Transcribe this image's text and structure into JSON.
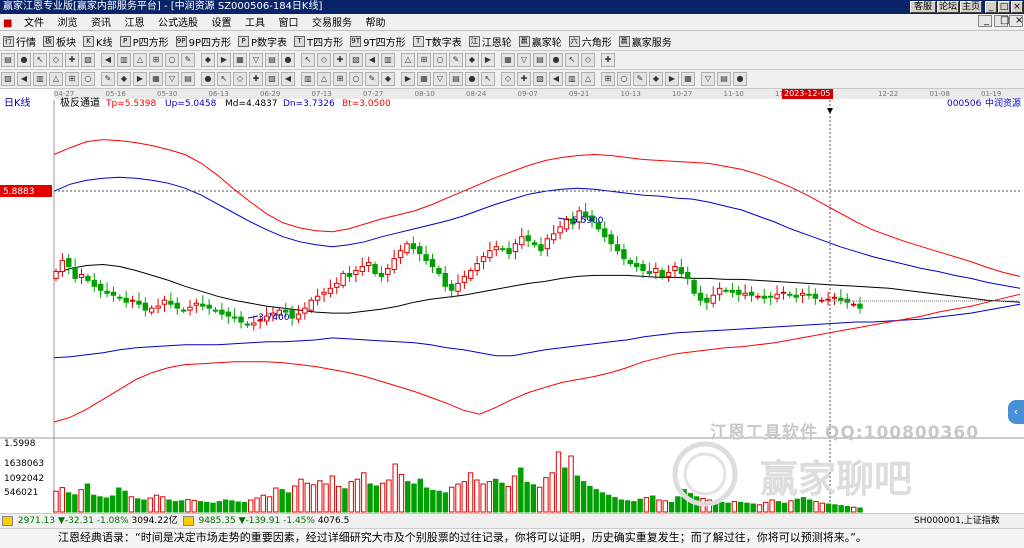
{
  "window": {
    "title": "赢家江恩专业版[赢家内部服务平台] - [中润资源  SZ000506-184日K线]",
    "buttons": [
      "客服",
      "论坛",
      "主页"
    ],
    "controls": [
      "_",
      "□",
      "×"
    ]
  },
  "menu": [
    "文件",
    "浏览",
    "资讯",
    "江恩",
    "公式选股",
    "设置",
    "工具",
    "窗口",
    "交易服务",
    "帮助"
  ],
  "toolbar1": [
    {
      "icon": "行",
      "label": "行情"
    },
    {
      "icon": "板",
      "label": "板块"
    },
    {
      "icon": "K",
      "label": "K线"
    },
    {
      "icon": "P",
      "label": "P四方形"
    },
    {
      "icon": "9P",
      "label": "9P四方形"
    },
    {
      "icon": "P",
      "label": "P数字表"
    },
    {
      "icon": "T",
      "label": "T四方形"
    },
    {
      "icon": "9T",
      "label": "9T四方形"
    },
    {
      "icon": "T",
      "label": "T数字表"
    },
    {
      "icon": "江",
      "label": "江恩轮"
    },
    {
      "icon": "赢",
      "label": "赢家轮"
    },
    {
      "icon": "六",
      "label": "六角形"
    },
    {
      "icon": "赢",
      "label": "赢家服务"
    }
  ],
  "toolbar2_count": 37,
  "toolbar3_count": 45,
  "panel": {
    "period_label": "日K线",
    "indicator": "极反通道",
    "stock_code": "000506",
    "stock_name": "中润资源"
  },
  "legend": [
    {
      "label": "Tp=5.5398",
      "color": "#ff0000"
    },
    {
      "label": "Up=5.0458",
      "color": "#0000cc"
    },
    {
      "label": "Md=4.4837",
      "color": "#000000"
    },
    {
      "label": "Dn=3.7326",
      "color": "#0000cc"
    },
    {
      "label": "Bt=3.0500",
      "color": "#ff0000"
    }
  ],
  "price_marker": "5.8883",
  "annotations": {
    "high": "5.5900",
    "low": "3.7400"
  },
  "dates": [
    "04-27",
    "05-16",
    "05-30",
    "06-13",
    "06-29",
    "07-13",
    "07-27",
    "08-10",
    "08-24",
    "09-07",
    "09-21",
    "10-13",
    "10-27",
    "11-10",
    "11-24",
    "2023-12-05",
    "12-22",
    "01-08",
    "01-19"
  ],
  "volume_labels": [
    "1.5998",
    "1638063",
    "1092042",
    "546021"
  ],
  "status": {
    "sh_index": "2971.13",
    "sh_change": "▼-32.31",
    "sh_pct": "-1.08%",
    "sh_amount": "3094.22亿",
    "sz_index": "9485.35",
    "sz_change": "▼-139.91",
    "sz_pct": "-1.45%",
    "sz_amount": "4076.5",
    "right_code": "SH000001,上证指数"
  },
  "quote": "江恩经典语录：“时间是决定市场走势的重要因素，经过详细研究大市及个别股票的过往记录，你将可以证明，历史确实重复发生；而了解过往，你将可以预测将来。”。",
  "watermark": {
    "line1": "江恩工具软件  QQ:100800360",
    "line2": "赢家聊吧"
  },
  "colors": {
    "up": "#e00000",
    "down": "#00a000",
    "tp": "#ff0000",
    "up_line": "#0000cc",
    "md": "#000000"
  },
  "chart_data": {
    "type": "candlestick",
    "ylim": [
      2.9,
      6.3
    ],
    "series_lines": {
      "tp": [
        5.75,
        5.82,
        5.88,
        5.9,
        5.89,
        5.87,
        5.84,
        5.8,
        5.75,
        5.66,
        5.54,
        5.4,
        5.27,
        5.15,
        5.06,
        5.01,
        4.98,
        4.97,
        5.0,
        5.05,
        5.1,
        5.14,
        5.18,
        5.24,
        5.31,
        5.38,
        5.45,
        5.52,
        5.58,
        5.64,
        5.69,
        5.72,
        5.74,
        5.75,
        5.74,
        5.72,
        5.7,
        5.69,
        5.68,
        5.67,
        5.66,
        5.63,
        5.6,
        5.55,
        5.49,
        5.42,
        5.34,
        5.25,
        5.16,
        5.07,
        4.99,
        4.93,
        4.87,
        4.82,
        4.77,
        4.72,
        4.67,
        4.61,
        4.56,
        4.52
      ],
      "up": [
        5.38,
        5.45,
        5.49,
        5.51,
        5.52,
        5.51,
        5.49,
        5.46,
        5.41,
        5.34,
        5.25,
        5.16,
        5.07,
        4.99,
        4.92,
        4.87,
        4.84,
        4.82,
        4.84,
        4.87,
        4.92,
        4.96,
        5.0,
        5.04,
        5.08,
        5.13,
        5.19,
        5.25,
        5.3,
        5.35,
        5.38,
        5.4,
        5.41,
        5.4,
        5.38,
        5.36,
        5.34,
        5.33,
        5.31,
        5.3,
        5.27,
        5.23,
        5.19,
        5.13,
        5.07,
        5.0,
        4.94,
        4.88,
        4.82,
        4.77,
        4.72,
        4.68,
        4.64,
        4.6,
        4.57,
        4.53,
        4.5,
        4.46,
        4.43,
        4.4
      ],
      "md": [
        4.55,
        4.6,
        4.63,
        4.64,
        4.62,
        4.58,
        4.53,
        4.48,
        4.42,
        4.37,
        4.32,
        4.28,
        4.25,
        4.22,
        4.2,
        4.18,
        4.16,
        4.15,
        4.15,
        4.17,
        4.19,
        4.22,
        4.26,
        4.29,
        4.31,
        4.33,
        4.36,
        4.39,
        4.42,
        4.45,
        4.47,
        4.5,
        4.52,
        4.53,
        4.53,
        4.53,
        4.52,
        4.51,
        4.51,
        4.5,
        4.5,
        4.49,
        4.49,
        4.48,
        4.47,
        4.46,
        4.45,
        4.44,
        4.43,
        4.42,
        4.41,
        4.4,
        4.38,
        4.36,
        4.34,
        4.32,
        4.3,
        4.28,
        4.27,
        4.26
      ],
      "dn": [
        3.7,
        3.71,
        3.73,
        3.75,
        3.78,
        3.8,
        3.81,
        3.82,
        3.83,
        3.83,
        3.83,
        3.84,
        3.85,
        3.86,
        3.86,
        3.87,
        3.88,
        3.9,
        3.89,
        3.88,
        3.87,
        3.86,
        3.85,
        3.83,
        3.8,
        3.78,
        3.75,
        3.72,
        3.72,
        3.75,
        3.78,
        3.8,
        3.82,
        3.84,
        3.86,
        3.88,
        3.91,
        3.93,
        3.95,
        3.96,
        3.97,
        3.98,
        3.99,
        4.0,
        4.01,
        4.02,
        4.03,
        4.04,
        4.05,
        4.06,
        4.06,
        4.07,
        4.08,
        4.09,
        4.11,
        4.13,
        4.15,
        4.18,
        4.21,
        4.24
      ],
      "bt": [
        3.05,
        3.1,
        3.18,
        3.28,
        3.38,
        3.48,
        3.55,
        3.6,
        3.63,
        3.64,
        3.65,
        3.66,
        3.66,
        3.66,
        3.65,
        3.63,
        3.61,
        3.58,
        3.55,
        3.51,
        3.46,
        3.41,
        3.36,
        3.3,
        3.24,
        3.17,
        3.13,
        3.2,
        3.28,
        3.35,
        3.4,
        3.45,
        3.48,
        3.51,
        3.55,
        3.6,
        3.66,
        3.7,
        3.74,
        3.76,
        3.78,
        3.8,
        3.81,
        3.83,
        3.85,
        3.88,
        3.91,
        3.94,
        3.97,
        4.0,
        4.03,
        4.06,
        4.09,
        4.12,
        4.16,
        4.19,
        4.22,
        4.26,
        4.3,
        4.34
      ]
    },
    "candles_close": [
      4.57,
      4.68,
      4.62,
      4.5,
      4.54,
      4.48,
      4.42,
      4.38,
      4.35,
      4.33,
      4.3,
      4.26,
      4.28,
      4.24,
      4.18,
      4.2,
      4.22,
      4.28,
      4.24,
      4.2,
      4.18,
      4.21,
      4.25,
      4.22,
      4.2,
      4.18,
      4.14,
      4.12,
      4.1,
      4.06,
      4.03,
      4.05,
      4.08,
      4.12,
      4.15,
      4.18,
      4.16,
      4.1,
      4.14,
      4.2,
      4.28,
      4.32,
      4.36,
      4.4,
      4.45,
      4.55,
      4.52,
      4.58,
      4.62,
      4.66,
      4.55,
      4.52,
      4.6,
      4.7,
      4.78,
      4.85,
      4.8,
      4.75,
      4.68,
      4.62,
      4.55,
      4.42,
      4.38,
      4.45,
      4.52,
      4.58,
      4.65,
      4.72,
      4.78,
      4.82,
      4.8,
      4.75,
      4.85,
      4.92,
      4.88,
      4.84,
      4.78,
      4.9,
      4.95,
      5.02,
      5.1,
      5.05,
      5.18,
      5.12,
      5.08,
      5.0,
      4.92,
      4.85,
      4.78,
      4.7,
      4.65,
      4.62,
      4.58,
      4.55,
      4.6,
      4.52,
      4.56,
      4.62,
      4.55,
      4.5,
      4.35,
      4.28,
      4.26,
      4.33,
      4.4,
      4.38,
      4.36,
      4.34,
      4.35,
      4.33,
      4.32,
      4.3,
      4.31,
      4.34,
      4.36,
      4.33,
      4.31,
      4.35,
      4.33,
      4.3,
      4.28,
      4.29,
      4.31,
      4.28,
      4.26,
      4.24,
      4.2
    ],
    "volume": [
      520,
      610,
      480,
      430,
      560,
      700,
      420,
      380,
      350,
      400,
      600,
      520,
      380,
      330,
      300,
      350,
      420,
      380,
      300,
      260,
      280,
      310,
      290,
      260,
      240,
      220,
      260,
      300,
      280,
      250,
      240,
      300,
      350,
      420,
      380,
      600,
      560,
      480,
      650,
      820,
      720,
      680,
      780,
      700,
      900,
      640,
      580,
      760,
      820,
      980,
      700,
      650,
      720,
      800,
      1200,
      940,
      760,
      700,
      820,
      600,
      540,
      520,
      480,
      620,
      700,
      760,
      980,
      800,
      700,
      760,
      820,
      720,
      640,
      900,
      1100,
      740,
      680,
      620,
      860,
      980,
      1500,
      1100,
      1400,
      900,
      760,
      640,
      560,
      480,
      420,
      360,
      300,
      280,
      260,
      320,
      360,
      400,
      300,
      280,
      240,
      380,
      560,
      460,
      380,
      340,
      300,
      260,
      240,
      220,
      260,
      240,
      220,
      200,
      180,
      240,
      300,
      260,
      220,
      280,
      320,
      360,
      300,
      260,
      220,
      200,
      180,
      160,
      140,
      120,
      100
    ],
    "vol_ylim": [
      0,
      1650000
    ]
  }
}
